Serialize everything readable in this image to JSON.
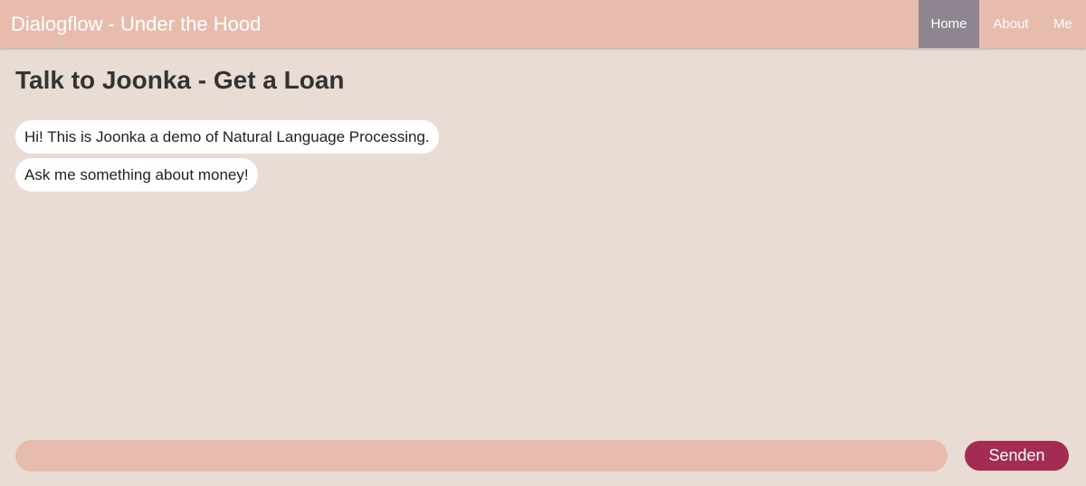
{
  "navbar": {
    "brand": "Dialogflow - Under the Hood",
    "items": [
      {
        "label": "Home",
        "active": true
      },
      {
        "label": "About",
        "active": false
      },
      {
        "label": "Me",
        "active": false
      }
    ]
  },
  "main": {
    "title": "Talk to Joonka - Get a Loan",
    "messages": [
      {
        "text": "Hi! This is Joonka a demo of Natural Language Processing."
      },
      {
        "text": "Ask me something about money!"
      }
    ]
  },
  "composer": {
    "input_value": "",
    "input_placeholder": "",
    "send_label": "Senden"
  },
  "colors": {
    "navbar": "#e8bcac",
    "active_tab": "#8e8591",
    "background": "#e8dcd4",
    "send_button": "#a22c52"
  }
}
